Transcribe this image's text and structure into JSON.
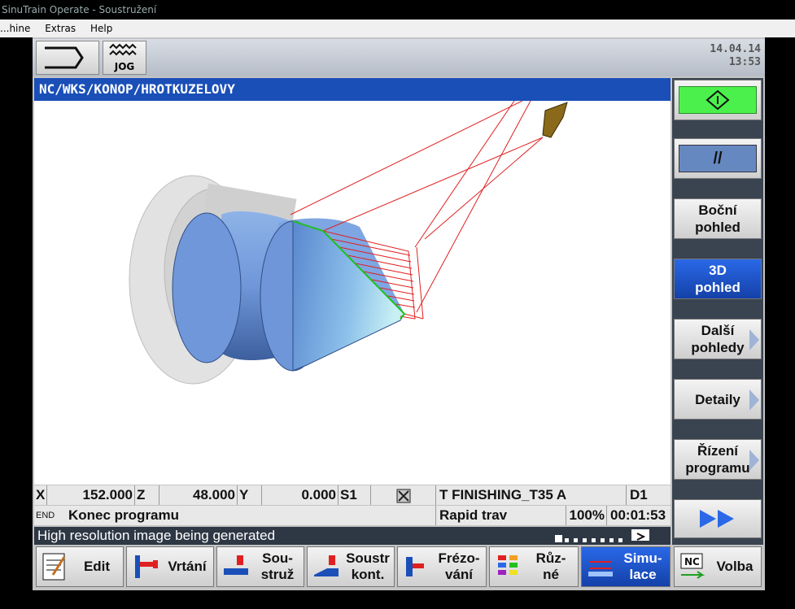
{
  "window": {
    "title": "SinuTrain Operate - Soustružení"
  },
  "menu": {
    "items": [
      "...hine",
      "Extras",
      "Help"
    ]
  },
  "header": {
    "jog_label": "JOG",
    "date": "14.04.14",
    "time": "13:53"
  },
  "program_path": "NC/WKS/KONOP/HROTKUZELOVY",
  "softkeys_right": [
    {
      "lines": [
        "",
        ""
      ],
      "id": "cycle-start"
    },
    {
      "lines": [
        "//",
        ""
      ],
      "id": "pause"
    },
    {
      "lines": [
        "Boční",
        "pohled"
      ],
      "id": "side-view"
    },
    {
      "lines": [
        "3D",
        "pohled"
      ],
      "id": "3d-view"
    },
    {
      "lines": [
        "Další",
        "pohledy"
      ],
      "id": "more-views"
    },
    {
      "lines": [
        "Detaily",
        ""
      ],
      "id": "details"
    },
    {
      "lines": [
        "Řízení",
        "programu"
      ],
      "id": "program-control"
    },
    {
      "lines": [
        "",
        ""
      ],
      "id": "fast-forward"
    }
  ],
  "status": {
    "x_label": "X",
    "x_value": "152.000",
    "z_label": "Z",
    "z_value": "48.000",
    "y_label": "Y",
    "y_value": "0.000",
    "s_label": "S1",
    "tool": "T FINISHING_T35 A",
    "d_label": "D1",
    "end_label": "END",
    "end_text": "Konec programu",
    "feed_mode": "Rapid trav",
    "override": "100%",
    "time": "00:01:53"
  },
  "message": "High resolution image being generated",
  "softkeys_bottom": [
    {
      "lines": [
        "Edit",
        ""
      ],
      "id": "edit"
    },
    {
      "lines": [
        "Vrtání",
        ""
      ],
      "id": "drilling"
    },
    {
      "lines": [
        "Sou-",
        "struž"
      ],
      "id": "turning"
    },
    {
      "lines": [
        "Soustr",
        "kont."
      ],
      "id": "contour-turning"
    },
    {
      "lines": [
        "Frézo-",
        "vání"
      ],
      "id": "milling"
    },
    {
      "lines": [
        "Růz-",
        "né"
      ],
      "id": "various"
    },
    {
      "lines": [
        "Simu-",
        "lace"
      ],
      "id": "simulation"
    },
    {
      "lines": [
        "Volba",
        ""
      ],
      "id": "select"
    }
  ],
  "colors": {
    "accent_blue": "#1a4fb8",
    "start_green": "#4cf04c",
    "toolpath_red": "#e02020",
    "contour_green": "#20c020"
  }
}
